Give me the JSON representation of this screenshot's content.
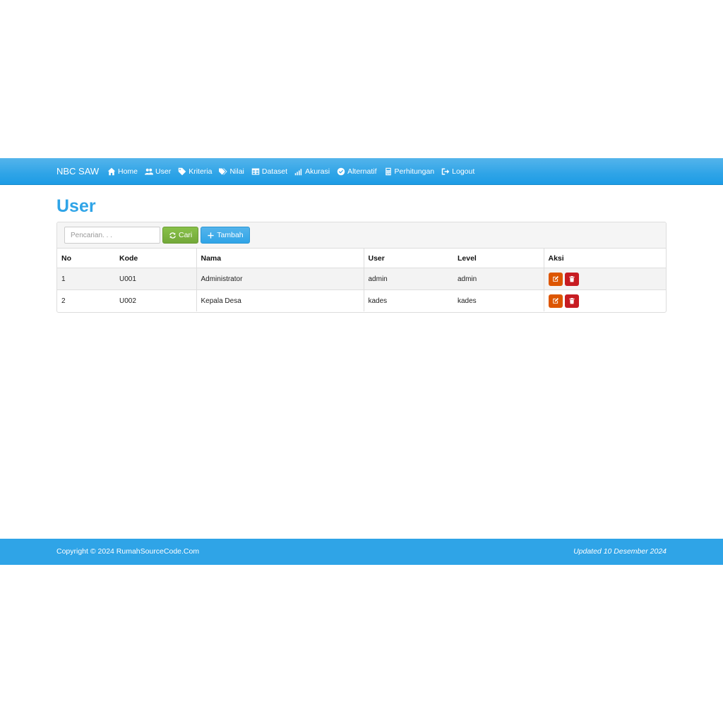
{
  "navbar": {
    "brand": "NBC SAW",
    "items": [
      {
        "label": "Home",
        "icon": "home-icon"
      },
      {
        "label": "User",
        "icon": "users-icon"
      },
      {
        "label": "Kriteria",
        "icon": "tag-icon"
      },
      {
        "label": "Nilai",
        "icon": "tags-icon"
      },
      {
        "label": "Dataset",
        "icon": "table-icon"
      },
      {
        "label": "Akurasi",
        "icon": "signal-icon"
      },
      {
        "label": "Alternatif",
        "icon": "check-circle-icon"
      },
      {
        "label": "Perhitungan",
        "icon": "calculator-icon"
      },
      {
        "label": "Logout",
        "icon": "sign-out-icon"
      }
    ]
  },
  "main": {
    "title": "User",
    "toolbar": {
      "search_placeholder": "Pencarian. . .",
      "search_value": "",
      "search_button": "Cari",
      "add_button": "Tambah"
    },
    "table": {
      "headers": [
        "No",
        "Kode",
        "Nama",
        "User",
        "Level",
        "Aksi"
      ],
      "rows": [
        [
          "1",
          "U001",
          "Administrator",
          "admin",
          "admin"
        ],
        [
          "2",
          "U002",
          "Kepala Desa",
          "kades",
          "kades"
        ]
      ]
    }
  },
  "footer": {
    "copyright": "Copyright © 2024 RumahSourceCode.Com",
    "updated": "Updated 10 Desember 2024"
  },
  "colors": {
    "primary": "#2fa4e7",
    "success": "#73a839",
    "warning": "#dd5600",
    "danger": "#c71c22"
  }
}
